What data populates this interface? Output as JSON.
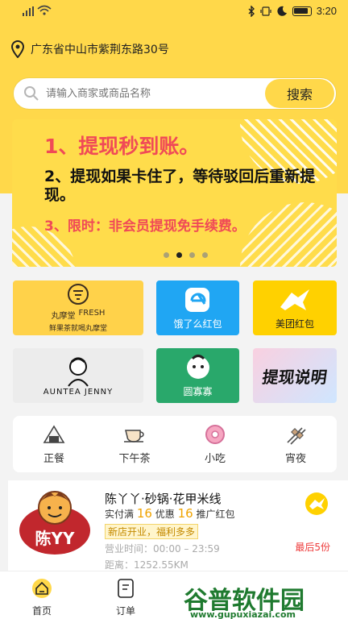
{
  "status": {
    "time": "3:20"
  },
  "location": {
    "text": "广东省中山市紫荆东路30号"
  },
  "search": {
    "placeholder": "请输入商家或商品名称",
    "button": "搜索"
  },
  "banner": {
    "line1": "1、提现秒到账。",
    "line2": "2、提现如果卡住了，等待驳回后重新提现。",
    "line3": "3、限时：非会员提现免手续费。",
    "dots_count": 4,
    "active_dot": 1
  },
  "promos": [
    {
      "label": "丸摩堂",
      "sub": "FRESH",
      "caption": "鲜果茶就喝丸摩堂",
      "icon": "wanmotang-logo"
    },
    {
      "label": "饿了么红包",
      "icon": "eleme-logo"
    },
    {
      "label": "美团红包",
      "icon": "meituan-logo"
    },
    {
      "label": "AUNTEA JENNY",
      "icon": "auntea-logo"
    },
    {
      "label": "圆寡寡",
      "icon": "yuanguagua-logo"
    },
    {
      "label": "提现说明",
      "icon": "withdraw-help"
    }
  ],
  "categories": [
    {
      "label": "正餐",
      "icon": "riceball-icon"
    },
    {
      "label": "下午茶",
      "icon": "teacup-icon"
    },
    {
      "label": "小吃",
      "icon": "donut-icon"
    },
    {
      "label": "宵夜",
      "icon": "skewer-icon"
    }
  ],
  "shop": {
    "name": "陈丫丫·砂锅·花甲米线",
    "actual_prefix": "实付满",
    "actual_amount": "16",
    "discount_label": "优惠",
    "discount_amount": "16",
    "promo_label": "推广红包",
    "new_tag": "新店开业，福利多多",
    "hours": "营业时间：00:00 – 23:59",
    "distance": "距离：1252.55KM",
    "badge": "最后5份",
    "logo_text": "陈YY"
  },
  "tabs": [
    {
      "label": "首页",
      "icon": "home-icon"
    },
    {
      "label": "订单",
      "icon": "orders-icon"
    }
  ],
  "watermark": {
    "text": "谷普软件园",
    "url": "www.gupuxiazai.com"
  },
  "colors": {
    "accent": "#ffd84a",
    "highlight": "#f04a57",
    "eleme": "#20a6f3",
    "meituan": "#ffd100",
    "green": "#29a86b"
  }
}
